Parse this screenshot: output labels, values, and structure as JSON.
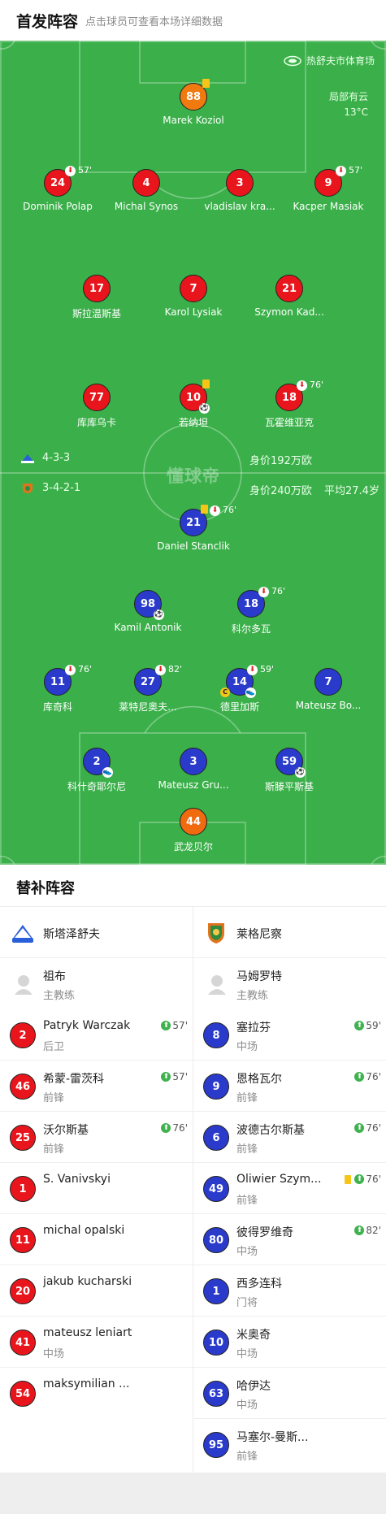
{
  "header": {
    "title": "首发阵容",
    "subtitle": "点击球员可查看本场详细数据"
  },
  "venue": {
    "name": "热舒夫市体育场",
    "icon": "stadium-icon"
  },
  "weather": {
    "condition": "局部有云",
    "temperature": "13°C"
  },
  "watermark": "懂球帝",
  "home_team": {
    "formation": "4-3-3",
    "market_value": "身价192万欧"
  },
  "away_team": {
    "formation": "3-4-2-1",
    "market_value": "身价240万欧",
    "average_age": "平均27.4岁"
  },
  "colors": {
    "pitch": "#3bb04a",
    "home": "#e8161c",
    "away": "#2a3bcc",
    "keeper_home": "#f07a10",
    "keeper_away": "#f06a10",
    "yellow_card": "#f5c518"
  },
  "home_players": [
    {
      "number": "88",
      "name": "Marek Koziol",
      "keeper": true,
      "yellow": true
    },
    {
      "number": "24",
      "name": "Dominik Polap",
      "sub_min": "57'"
    },
    {
      "number": "4",
      "name": "Michal Synos"
    },
    {
      "number": "3",
      "name": "vladislav kra..."
    },
    {
      "number": "9",
      "name": "Kacper Masiak",
      "sub_min": "57'"
    },
    {
      "number": "17",
      "name": "斯拉温斯基"
    },
    {
      "number": "7",
      "name": "Karol Lysiak"
    },
    {
      "number": "21",
      "name": "Szymon Kad..."
    },
    {
      "number": "77",
      "name": "库库乌卡"
    },
    {
      "number": "10",
      "name": "若纳坦",
      "yellow": true,
      "goal": true
    },
    {
      "number": "18",
      "name": "瓦霍维亚克",
      "sub_min": "76'"
    }
  ],
  "away_players": [
    {
      "number": "21",
      "name": "Daniel Stanclik",
      "yellow": true,
      "sub_min": "76'"
    },
    {
      "number": "98",
      "name": "Kamil Antonik",
      "goal": true
    },
    {
      "number": "18",
      "name": "科尔多瓦",
      "sub_min": "76'"
    },
    {
      "number": "11",
      "name": "库奇科",
      "sub_min": "76'"
    },
    {
      "number": "27",
      "name": "莱特尼奥夫...",
      "sub_min": "82'"
    },
    {
      "number": "14",
      "name": "德里加斯",
      "sub_min": "59'",
      "captain": true,
      "assist": true
    },
    {
      "number": "7",
      "name": "Mateusz Bo..."
    },
    {
      "number": "2",
      "name": "科什奇耶尔尼",
      "assist": true
    },
    {
      "number": "3",
      "name": "Mateusz Gru..."
    },
    {
      "number": "59",
      "name": "斯滕平斯基",
      "goal": true
    },
    {
      "number": "44",
      "name": "武龙贝尔",
      "keeper": true
    }
  ],
  "substitutes": {
    "title": "替补阵容",
    "home": {
      "team_name": "斯塔泽舒夫",
      "coach": {
        "name": "祖布",
        "role": "主教练"
      },
      "players": [
        {
          "number": "2",
          "name": "Patryk Warczak",
          "position": "后卫",
          "sub_min": "57'"
        },
        {
          "number": "46",
          "name": "希蒙-雷茨科",
          "position": "前锋",
          "sub_min": "57'"
        },
        {
          "number": "25",
          "name": "沃尔斯基",
          "position": "前锋",
          "sub_min": "76'"
        },
        {
          "number": "1",
          "name": "S. Vanivskyi",
          "position": ""
        },
        {
          "number": "11",
          "name": "michal opalski",
          "position": ""
        },
        {
          "number": "20",
          "name": "jakub kucharski",
          "position": ""
        },
        {
          "number": "41",
          "name": "mateusz leniart",
          "position": "中场"
        },
        {
          "number": "54",
          "name": "maksymilian ...",
          "position": ""
        }
      ]
    },
    "away": {
      "team_name": "莱格尼察",
      "coach": {
        "name": "马姆罗特",
        "role": "主教练"
      },
      "players": [
        {
          "number": "8",
          "name": "塞拉芬",
          "position": "中场",
          "sub_min": "59'"
        },
        {
          "number": "9",
          "name": "恩格瓦尔",
          "position": "前锋",
          "sub_min": "76'"
        },
        {
          "number": "6",
          "name": "波德古尔斯基",
          "position": "前锋",
          "sub_min": "76'"
        },
        {
          "number": "49",
          "name": "Oliwier Szym...",
          "position": "前锋",
          "sub_min": "76'",
          "yellow": true
        },
        {
          "number": "80",
          "name": "彼得罗维奇",
          "position": "中场",
          "sub_min": "82'"
        },
        {
          "number": "1",
          "name": "西多连科",
          "position": "门将"
        },
        {
          "number": "10",
          "name": "米奥奇",
          "position": "中场"
        },
        {
          "number": "63",
          "name": "哈伊达",
          "position": "中场"
        },
        {
          "number": "95",
          "name": "马塞尔-曼斯...",
          "position": "前锋"
        }
      ]
    }
  }
}
